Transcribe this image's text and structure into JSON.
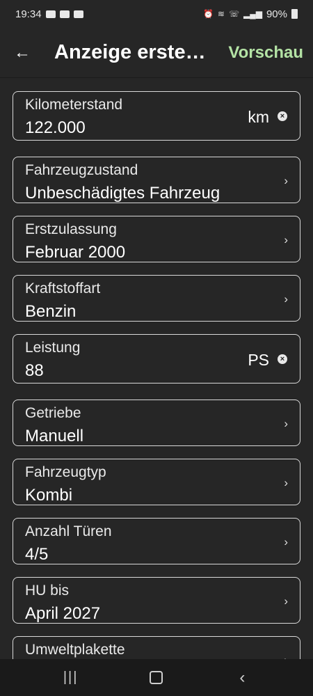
{
  "status": {
    "time": "19:34",
    "battery": "90%"
  },
  "header": {
    "title": "Anzeige erste…",
    "action": "Vorschau"
  },
  "fields": [
    {
      "label": "Kilometerstand",
      "value": "122.000",
      "unit": "km"
    },
    {
      "label": "Fahrzeugzustand",
      "value": "Unbeschädigtes Fahrzeug"
    },
    {
      "label": "Erstzulassung",
      "value": "Februar 2000"
    },
    {
      "label": "Kraftstoffart",
      "value": "Benzin"
    },
    {
      "label": "Leistung",
      "value": "88",
      "unit": "PS"
    },
    {
      "label": "Getriebe",
      "value": "Manuell"
    },
    {
      "label": "Fahrzeugtyp",
      "value": "Kombi"
    },
    {
      "label": "Anzahl Türen",
      "value": "4/5"
    },
    {
      "label": "HU bis",
      "value": "April 2027"
    },
    {
      "label": "Umweltplakette",
      "value": ""
    }
  ],
  "icons": {
    "back": "arrow-left",
    "chevron": "chevron-right",
    "clear": "clear-circle"
  }
}
